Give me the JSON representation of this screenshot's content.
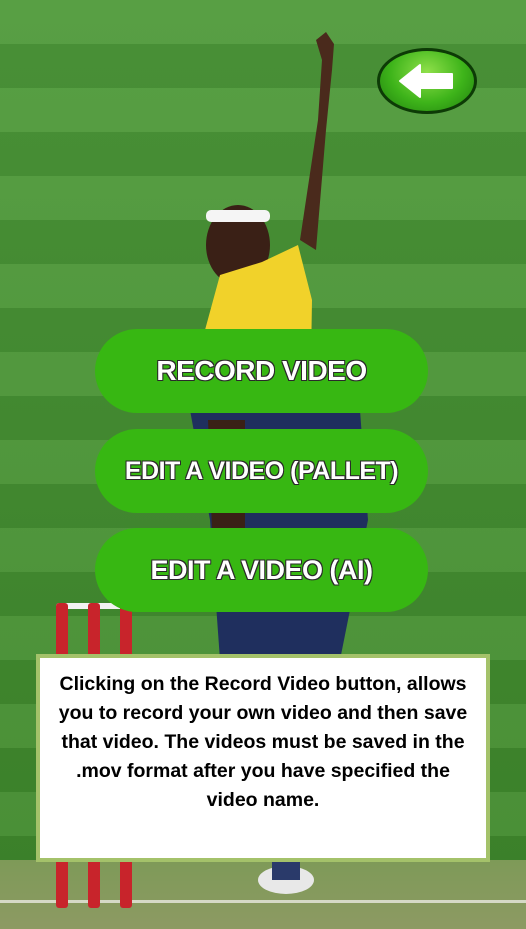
{
  "colors": {
    "button_green": "#37b712",
    "back_button_green": "#3eb41a",
    "info_border": "#a4c26a",
    "grass": "#4f9a3a"
  },
  "header": {
    "back_button_icon": "arrow-left-icon"
  },
  "menu": {
    "record_video_label": "RECORD VIDEO",
    "edit_pallet_label": "EDIT A VIDEO (PALLET)",
    "edit_ai_label": "EDIT A VIDEO (AI)"
  },
  "info": {
    "text": "Clicking on the Record Video button, allows you to record your own video and then save that video. The videos must be saved in the .mov format after you have specified the video name."
  }
}
